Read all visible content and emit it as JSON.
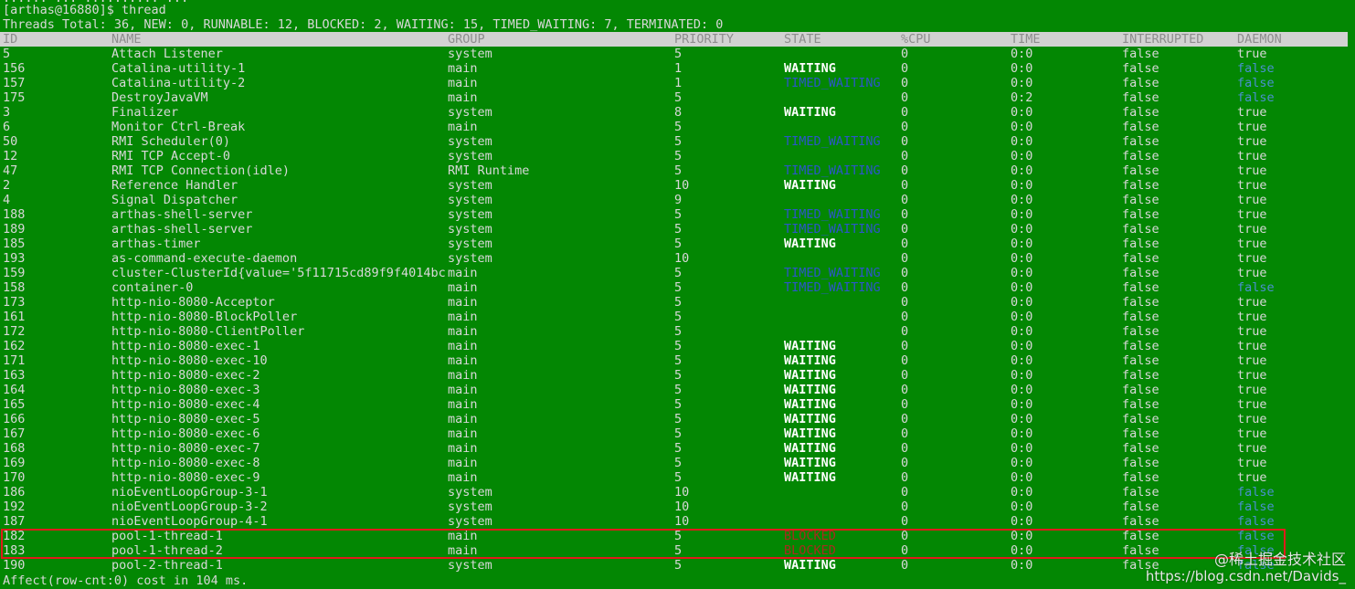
{
  "terminal": {
    "partial_top_line": "...... ... .......... ...",
    "prompt": "[arthas@16880]$ thread",
    "summary": "Threads Total: 36, NEW: 0, RUNNABLE: 12, BLOCKED: 2, WAITING: 15, TIMED_WAITING: 7, TERMINATED: 0",
    "footer": "Affect(row-cnt:0) cost in 104 ms."
  },
  "table": {
    "headers": [
      "ID",
      "NAME",
      "GROUP",
      "PRIORITY",
      "STATE",
      "%CPU",
      "TIME",
      "INTERRUPTED",
      "DAEMON"
    ],
    "rows": [
      {
        "id": "5",
        "name": "Attach Listener",
        "group": "system",
        "priority": "5",
        "state": "",
        "cpu": "0",
        "time": "0:0",
        "interrupted": "false",
        "daemon": "true"
      },
      {
        "id": "156",
        "name": "Catalina-utility-1",
        "group": "main",
        "priority": "1",
        "state": "WAITING",
        "cpu": "0",
        "time": "0:0",
        "interrupted": "false",
        "daemon": "false"
      },
      {
        "id": "157",
        "name": "Catalina-utility-2",
        "group": "main",
        "priority": "1",
        "state": "TIMED_WAITING",
        "cpu": "0",
        "time": "0:0",
        "interrupted": "false",
        "daemon": "false"
      },
      {
        "id": "175",
        "name": "DestroyJavaVM",
        "group": "main",
        "priority": "5",
        "state": "",
        "cpu": "0",
        "time": "0:2",
        "interrupted": "false",
        "daemon": "false"
      },
      {
        "id": "3",
        "name": "Finalizer",
        "group": "system",
        "priority": "8",
        "state": "WAITING",
        "cpu": "0",
        "time": "0:0",
        "interrupted": "false",
        "daemon": "true"
      },
      {
        "id": "6",
        "name": "Monitor Ctrl-Break",
        "group": "main",
        "priority": "5",
        "state": "",
        "cpu": "0",
        "time": "0:0",
        "interrupted": "false",
        "daemon": "true"
      },
      {
        "id": "50",
        "name": "RMI Scheduler(0)",
        "group": "system",
        "priority": "5",
        "state": "TIMED_WAITING",
        "cpu": "0",
        "time": "0:0",
        "interrupted": "false",
        "daemon": "true"
      },
      {
        "id": "12",
        "name": "RMI TCP Accept-0",
        "group": "system",
        "priority": "5",
        "state": "",
        "cpu": "0",
        "time": "0:0",
        "interrupted": "false",
        "daemon": "true"
      },
      {
        "id": "47",
        "name": "RMI TCP Connection(idle)",
        "group": "RMI Runtime",
        "priority": "5",
        "state": "TIMED_WAITING",
        "cpu": "0",
        "time": "0:0",
        "interrupted": "false",
        "daemon": "true"
      },
      {
        "id": "2",
        "name": "Reference Handler",
        "group": "system",
        "priority": "10",
        "state": "WAITING",
        "cpu": "0",
        "time": "0:0",
        "interrupted": "false",
        "daemon": "true"
      },
      {
        "id": "4",
        "name": "Signal Dispatcher",
        "group": "system",
        "priority": "9",
        "state": "",
        "cpu": "0",
        "time": "0:0",
        "interrupted": "false",
        "daemon": "true"
      },
      {
        "id": "188",
        "name": "arthas-shell-server",
        "group": "system",
        "priority": "5",
        "state": "TIMED_WAITING",
        "cpu": "0",
        "time": "0:0",
        "interrupted": "false",
        "daemon": "true"
      },
      {
        "id": "189",
        "name": "arthas-shell-server",
        "group": "system",
        "priority": "5",
        "state": "TIMED_WAITING",
        "cpu": "0",
        "time": "0:0",
        "interrupted": "false",
        "daemon": "true"
      },
      {
        "id": "185",
        "name": "arthas-timer",
        "group": "system",
        "priority": "5",
        "state": "WAITING",
        "cpu": "0",
        "time": "0:0",
        "interrupted": "false",
        "daemon": "true"
      },
      {
        "id": "193",
        "name": "as-command-execute-daemon",
        "group": "system",
        "priority": "10",
        "state": "",
        "cpu": "0",
        "time": "0:0",
        "interrupted": "false",
        "daemon": "true"
      },
      {
        "id": "159",
        "name": "cluster-ClusterId{value='5f11715cd89f9f4014bc",
        "group": "main",
        "priority": "5",
        "state": "TIMED_WAITING",
        "cpu": "0",
        "time": "0:0",
        "interrupted": "false",
        "daemon": "true"
      },
      {
        "id": "158",
        "name": "container-0",
        "group": "main",
        "priority": "5",
        "state": "TIMED_WAITING",
        "cpu": "0",
        "time": "0:0",
        "interrupted": "false",
        "daemon": "false"
      },
      {
        "id": "173",
        "name": "http-nio-8080-Acceptor",
        "group": "main",
        "priority": "5",
        "state": "",
        "cpu": "0",
        "time": "0:0",
        "interrupted": "false",
        "daemon": "true"
      },
      {
        "id": "161",
        "name": "http-nio-8080-BlockPoller",
        "group": "main",
        "priority": "5",
        "state": "",
        "cpu": "0",
        "time": "0:0",
        "interrupted": "false",
        "daemon": "true"
      },
      {
        "id": "172",
        "name": "http-nio-8080-ClientPoller",
        "group": "main",
        "priority": "5",
        "state": "",
        "cpu": "0",
        "time": "0:0",
        "interrupted": "false",
        "daemon": "true"
      },
      {
        "id": "162",
        "name": "http-nio-8080-exec-1",
        "group": "main",
        "priority": "5",
        "state": "WAITING",
        "cpu": "0",
        "time": "0:0",
        "interrupted": "false",
        "daemon": "true"
      },
      {
        "id": "171",
        "name": "http-nio-8080-exec-10",
        "group": "main",
        "priority": "5",
        "state": "WAITING",
        "cpu": "0",
        "time": "0:0",
        "interrupted": "false",
        "daemon": "true"
      },
      {
        "id": "163",
        "name": "http-nio-8080-exec-2",
        "group": "main",
        "priority": "5",
        "state": "WAITING",
        "cpu": "0",
        "time": "0:0",
        "interrupted": "false",
        "daemon": "true"
      },
      {
        "id": "164",
        "name": "http-nio-8080-exec-3",
        "group": "main",
        "priority": "5",
        "state": "WAITING",
        "cpu": "0",
        "time": "0:0",
        "interrupted": "false",
        "daemon": "true"
      },
      {
        "id": "165",
        "name": "http-nio-8080-exec-4",
        "group": "main",
        "priority": "5",
        "state": "WAITING",
        "cpu": "0",
        "time": "0:0",
        "interrupted": "false",
        "daemon": "true"
      },
      {
        "id": "166",
        "name": "http-nio-8080-exec-5",
        "group": "main",
        "priority": "5",
        "state": "WAITING",
        "cpu": "0",
        "time": "0:0",
        "interrupted": "false",
        "daemon": "true"
      },
      {
        "id": "167",
        "name": "http-nio-8080-exec-6",
        "group": "main",
        "priority": "5",
        "state": "WAITING",
        "cpu": "0",
        "time": "0:0",
        "interrupted": "false",
        "daemon": "true"
      },
      {
        "id": "168",
        "name": "http-nio-8080-exec-7",
        "group": "main",
        "priority": "5",
        "state": "WAITING",
        "cpu": "0",
        "time": "0:0",
        "interrupted": "false",
        "daemon": "true"
      },
      {
        "id": "169",
        "name": "http-nio-8080-exec-8",
        "group": "main",
        "priority": "5",
        "state": "WAITING",
        "cpu": "0",
        "time": "0:0",
        "interrupted": "false",
        "daemon": "true"
      },
      {
        "id": "170",
        "name": "http-nio-8080-exec-9",
        "group": "main",
        "priority": "5",
        "state": "WAITING",
        "cpu": "0",
        "time": "0:0",
        "interrupted": "false",
        "daemon": "true"
      },
      {
        "id": "186",
        "name": "nioEventLoopGroup-3-1",
        "group": "system",
        "priority": "10",
        "state": "",
        "cpu": "0",
        "time": "0:0",
        "interrupted": "false",
        "daemon": "false"
      },
      {
        "id": "192",
        "name": "nioEventLoopGroup-3-2",
        "group": "system",
        "priority": "10",
        "state": "",
        "cpu": "0",
        "time": "0:0",
        "interrupted": "false",
        "daemon": "false"
      },
      {
        "id": "187",
        "name": "nioEventLoopGroup-4-1",
        "group": "system",
        "priority": "10",
        "state": "",
        "cpu": "0",
        "time": "0:0",
        "interrupted": "false",
        "daemon": "false"
      },
      {
        "id": "182",
        "name": "pool-1-thread-1",
        "group": "main",
        "priority": "5",
        "state": "BLOCKED",
        "cpu": "0",
        "time": "0:0",
        "interrupted": "false",
        "daemon": "false"
      },
      {
        "id": "183",
        "name": "pool-1-thread-2",
        "group": "main",
        "priority": "5",
        "state": "BLOCKED",
        "cpu": "0",
        "time": "0:0",
        "interrupted": "false",
        "daemon": "false"
      },
      {
        "id": "190",
        "name": "pool-2-thread-1",
        "group": "system",
        "priority": "5",
        "state": "WAITING",
        "cpu": "0",
        "time": "0:0",
        "interrupted": "false",
        "daemon": "false"
      }
    ]
  },
  "watermark": {
    "line1": "@稀土掘金技术社区",
    "line2": "https://blog.csdn.net/Davids_"
  },
  "colors": {
    "background": "#038703",
    "text": "#d8d8d8",
    "header_bg": "#d2d2d2",
    "waiting": "#ffffff",
    "timed_waiting": "#2c56c8",
    "blocked": "#a82b1e",
    "daemon_false": "#4a90d0",
    "highlight": "#e01b1b"
  }
}
